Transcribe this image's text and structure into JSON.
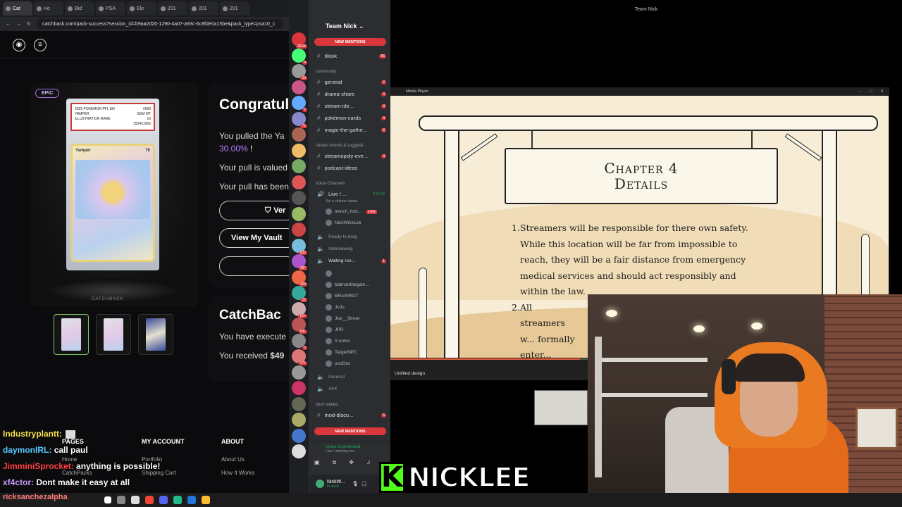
{
  "browser": {
    "tabs": [
      "Cat",
      "Ho",
      "Bid",
      "PSA",
      "Ele",
      "201",
      "201",
      "201"
    ],
    "url": "catchback.com/pack-success?session_id=b9aa2d20-1290-4a07-a93c-6c8fde0a15be&pack_type=psa10_c",
    "badge": "EPIC",
    "slab": {
      "line1": "2025 POKEMON PFL EN",
      "line2": "YAMPER",
      "line3": "ILLUSTRATION RARE",
      "grade_label": "#099",
      "grade": "GEM MT",
      "score": "10",
      "cert": "155451066"
    },
    "card_name": "Yamper",
    "card_hp": "70",
    "stand_label": "CATCHBACK",
    "congrats": "Congratul",
    "pulled_prefix": "You pulled the Ya",
    "pulled_pct": "30.00%",
    "pulled_suffix": "!",
    "valued": "Your pull is valued",
    "has_been": "Your pull has been",
    "verify_btn": "Ver",
    "vault_btn": "View My Vault",
    "catch_heading": "CatchBac",
    "executed": "You have execute",
    "received_prefix": "You received",
    "received_value": "$49",
    "footer": {
      "pages": {
        "title": "PAGES",
        "items": [
          "Home",
          "CatchPacks"
        ]
      },
      "account": {
        "title": "MY ACCOUNT",
        "items": [
          "Portfolio",
          "Shipping Cart"
        ]
      },
      "about": {
        "title": "ABOUT",
        "items": [
          "About Us",
          "How It Works"
        ]
      }
    }
  },
  "chat": [
    {
      "user": "Industryplantt:",
      "msg": "",
      "color": "#f4e04d"
    },
    {
      "user": "daymonIRL:",
      "msg": "call paul",
      "color": "#56c9ff"
    },
    {
      "user": "JimminiSprocket:",
      "msg": "anything is possible!",
      "color": "#ff4040"
    },
    {
      "user": "xf4ctor:",
      "msg": "Dont make it easy at all",
      "color": "#c79bff"
    }
  ],
  "chat_input": "ricksanchezalpha",
  "discord": {
    "server": "Team Nick",
    "new_mentions": "NEW MENTIONS",
    "tiktok": "tiktok",
    "tiktok_count": "66",
    "cat_community": "community",
    "channels": [
      {
        "name": "general",
        "count": "2"
      },
      {
        "name": "drama-share",
        "count": "4"
      },
      {
        "name": "stream-ide...",
        "count": "4"
      },
      {
        "name": "pokémon-cards",
        "count": "4"
      },
      {
        "name": "magic-the-gathe...",
        "count": "2"
      }
    ],
    "cat_stream": "stream events & suggesti...",
    "stream_channels": [
      {
        "name": "streamopoly-eve...",
        "count": "4"
      },
      {
        "name": "podcast-ideas",
        "count": ""
      }
    ],
    "cat_voice": "Voice Channels",
    "live_channel": "Live / ...",
    "live_time": "3:17:52",
    "live_status": "Set a channel status",
    "voice_users": [
      "trench_foot...",
      "NickWickLee"
    ],
    "ready": "Ready to drag",
    "interviewing": "Interviewing",
    "waiting": "Waiting roo...",
    "waiting_count": "1",
    "waiting_users": [
      "",
      "batmanthegam...",
      "BRAINROT",
      "JuJu",
      "Joe__Street",
      "JPR",
      "S kotos",
      "TargetNPC",
      "unoDos"
    ],
    "general_voice": "General",
    "afk": "AFK",
    "cat_mod": "Mod related",
    "mod_channel": "mod-discu...",
    "mod_count": "5",
    "voice_connected": "Voice Connected",
    "voice_sub": "Live / meeting roo...",
    "user_name": "NickW...",
    "user_status": "In voice",
    "live_label": "LIVE",
    "guild_badges": [
      "NEW",
      "4",
      "10",
      "",
      "2",
      "71",
      "",
      "",
      "",
      "",
      "",
      "",
      "",
      "832",
      "287",
      "168",
      "12",
      "1K+",
      "541",
      "n",
      "171",
      "",
      "",
      "",
      "",
      "",
      ""
    ]
  },
  "media_player": {
    "window_title": "Team Nick",
    "player_title": "Media Player",
    "slide_title_1": "Chapter 4",
    "slide_title_2": "Details",
    "rules": [
      {
        "num": "1.",
        "text": "Streamers will be responsible for there own safety. While this location will be far from impossible to reach, they will be a fair distance from emergency medical services and should act responsibly and within the law."
      },
      {
        "num": "2.",
        "text": "All streamers w... formally enter... legally."
      }
    ],
    "caption": "Untitled design",
    "progress": 0.38,
    "accent": "#e25a3c"
  },
  "streamer": {
    "badge_letter": "K",
    "name": "NICKLEE",
    "badge_color": "#53fc18"
  }
}
